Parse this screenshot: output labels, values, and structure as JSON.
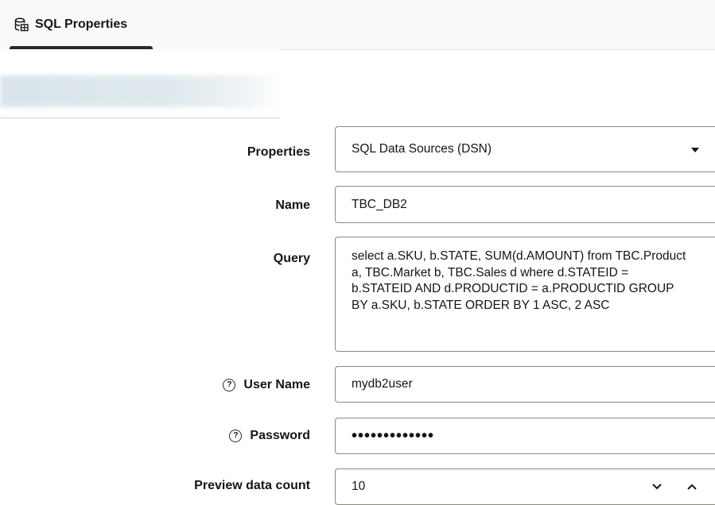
{
  "tab": {
    "label": "SQL Properties",
    "icon": "database-table-icon"
  },
  "form": {
    "properties": {
      "label": "Properties",
      "value": "SQL Data Sources (DSN)"
    },
    "name": {
      "label": "Name",
      "value": "TBC_DB2"
    },
    "query": {
      "label": "Query",
      "value": "select a.SKU, b.STATE, SUM(d.AMOUNT) from TBC.Product a, TBC.Market b, TBC.Sales d where d.STATEID = b.STATEID AND d.PRODUCTID = a.PRODUCTID GROUP BY a.SKU, b.STATE ORDER BY 1 ASC, 2 ASC"
    },
    "user_name": {
      "label": "User Name",
      "value": "mydb2user",
      "help_icon": "help-icon"
    },
    "password": {
      "label": "Password",
      "value": "•••••••••••••",
      "help_icon": "help-icon"
    },
    "preview_count": {
      "label": "Preview data count",
      "value": "10"
    }
  },
  "colors": {
    "accent_tab_underline": "#2b2926",
    "border": "#8d8983",
    "tabbar_bg": "#fbf9f8"
  }
}
